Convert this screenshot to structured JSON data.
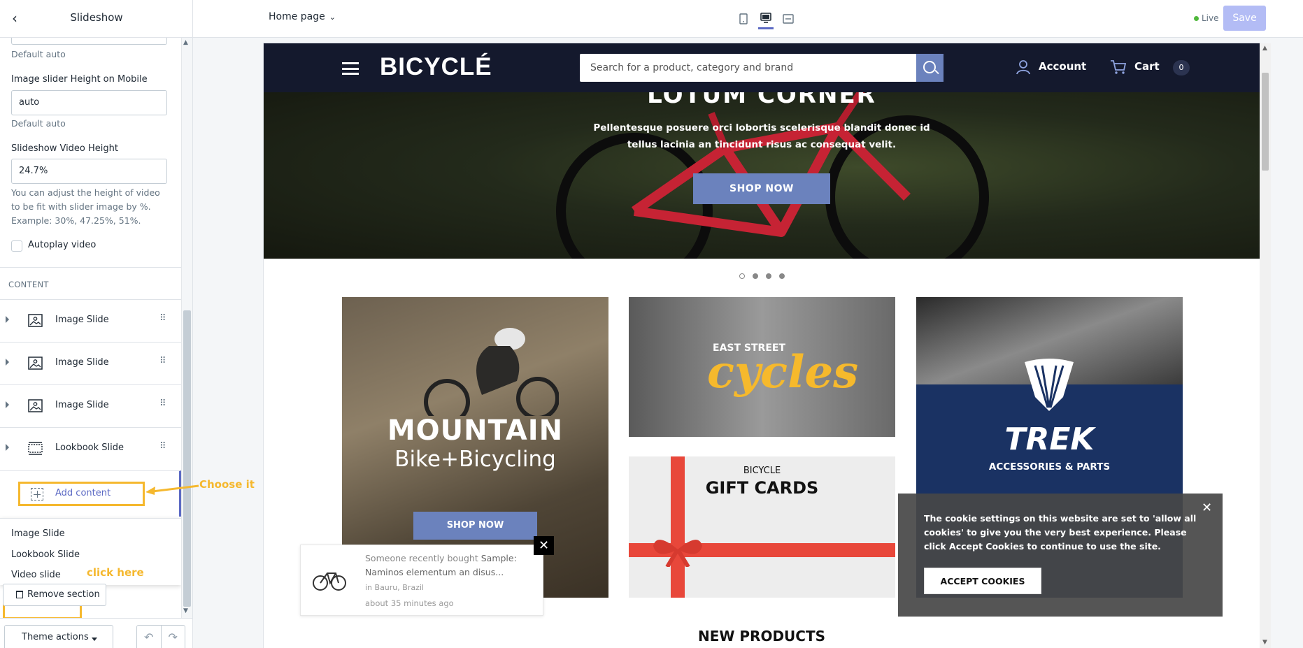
{
  "topbar": {
    "back_icon": "chevron-left-icon",
    "sidebar_title": "Slideshow",
    "page_select": "Home page",
    "live_label": "Live",
    "save_label": "Save",
    "device_icons": [
      "mobile-icon",
      "desktop-icon",
      "fullscreen-icon"
    ]
  },
  "sidebar": {
    "default_auto_1": "Default auto",
    "mobile_height_label": "Image slider Height on Mobile",
    "mobile_height_value": "auto",
    "default_auto_2": "Default auto",
    "video_height_label": "Slideshow Video Height",
    "video_height_value": "24.7%",
    "video_height_hint": "You can adjust the height of video to be fit with slider image by %. Example: 30%, 47.25%, 51%.",
    "autoplay_label": "Autoplay video",
    "content_title": "CONTENT",
    "blocks": [
      {
        "label": "Image Slide",
        "icon": "image-icon"
      },
      {
        "label": "Image Slide",
        "icon": "image-icon"
      },
      {
        "label": "Image Slide",
        "icon": "image-icon"
      },
      {
        "label": "Lookbook Slide",
        "icon": "lookbook-icon"
      }
    ],
    "add_content_label": "Add content",
    "annotation_choose": "Choose it",
    "menu": [
      "Image Slide",
      "Lookbook Slide",
      "Video slide"
    ],
    "annotation_click": "click here",
    "remove_label": "Remove section",
    "theme_actions_label": "Theme actions"
  },
  "site": {
    "logo": "BICYCLÉ",
    "search_placeholder": "Search for a product, category and brand",
    "account": "Account",
    "cart": "Cart",
    "cart_count": "0",
    "hero_text": "Pellentesque posuere orci lobortis scelerisque blandit donec id tellus lacinia an tincidunt risus ac consequat velit.",
    "hero_button": "SHOP NOW",
    "tile_mountain_title": "MOUNTAIN",
    "tile_mountain_sub": "Bike+Bicycling",
    "tile_mountain_button": "SHOP NOW",
    "tile_east_top": "EAST STREET",
    "tile_east_script": "cycles",
    "tile_gift_top": "BICYCLE",
    "tile_gift_main": "GIFT CARDS",
    "tile_trek_logo": "TREK",
    "tile_trek_sub": "ACCESSORIES & PARTS",
    "toast_prefix": "Someone recently bought",
    "toast_product": "Sample: Naminos elementum an disus...",
    "toast_location": "in Bauru, Brazil",
    "toast_time": "about 35 minutes ago",
    "cookie_text": "The cookie settings on this website are set to 'allow all cookies' to give you the very best experience. Please click Accept Cookies to continue to use the site.",
    "cookie_button": "ACCEPT COOKIES",
    "new_products": "NEW PRODUCTS"
  },
  "colors": {
    "accent": "#5c6ac4",
    "annotation": "#f5b82e",
    "site_header": "#14192d",
    "site_button": "#6b82bd"
  }
}
